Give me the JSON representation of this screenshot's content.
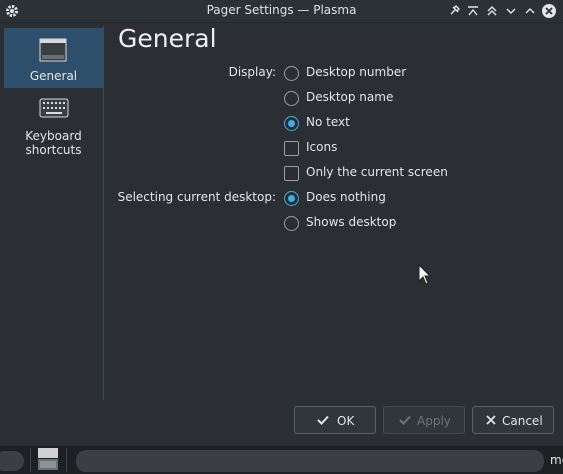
{
  "window": {
    "title": "Pager Settings — Plasma"
  },
  "sidebar": {
    "items": [
      {
        "label": "General",
        "icon": "desktop-icon",
        "active": true
      },
      {
        "label": "Keyboard shortcuts",
        "label_line1": "Keyboard",
        "label_line2": "shortcuts",
        "icon": "keyboard-icon",
        "active": false
      }
    ]
  },
  "page": {
    "title": "General"
  },
  "display": {
    "label": "Display:",
    "options": [
      {
        "type": "radio",
        "label": "Desktop number",
        "checked": false
      },
      {
        "type": "radio",
        "label": "Desktop name",
        "checked": false
      },
      {
        "type": "radio",
        "label": "No text",
        "checked": true
      },
      {
        "type": "checkbox",
        "label": "Icons",
        "checked": false
      },
      {
        "type": "checkbox",
        "label": "Only the current screen",
        "checked": false
      }
    ]
  },
  "selecting": {
    "label": "Selecting current desktop:",
    "options": [
      {
        "type": "radio",
        "label": "Does nothing",
        "checked": true
      },
      {
        "type": "radio",
        "label": "Shows desktop",
        "checked": false
      }
    ]
  },
  "buttons": {
    "ok": "OK",
    "apply": "Apply",
    "cancel": "Cancel"
  },
  "taskbar": {
    "partial_text": "me"
  },
  "colors": {
    "accent": "#3daee9",
    "active_item": "#2d4f6c",
    "background": "#2b2f33"
  }
}
